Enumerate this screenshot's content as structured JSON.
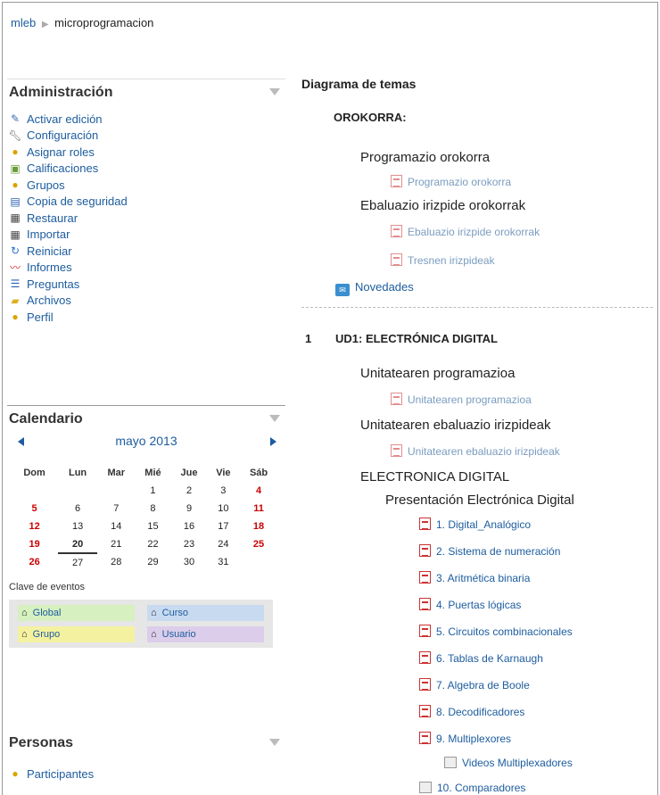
{
  "breadcrumb": {
    "home": "mleb",
    "current": "microprogramacion"
  },
  "admin": {
    "title": "Administración",
    "items": [
      {
        "label": "Activar edición",
        "icon": "pencil-icon"
      },
      {
        "label": "Configuración",
        "icon": "wrench-icon"
      },
      {
        "label": "Asignar roles",
        "icon": "roles-icon"
      },
      {
        "label": "Calificaciones",
        "icon": "grades-icon"
      },
      {
        "label": "Grupos",
        "icon": "groups-icon"
      },
      {
        "label": "Copia de seguridad",
        "icon": "backup-icon"
      },
      {
        "label": "Restaurar",
        "icon": "restore-icon"
      },
      {
        "label": "Importar",
        "icon": "import-icon"
      },
      {
        "label": "Reiniciar",
        "icon": "reset-icon"
      },
      {
        "label": "Informes",
        "icon": "reports-icon"
      },
      {
        "label": "Preguntas",
        "icon": "questions-icon"
      },
      {
        "label": "Archivos",
        "icon": "files-icon"
      },
      {
        "label": "Perfil",
        "icon": "profile-icon"
      }
    ]
  },
  "calendar": {
    "title": "Calendario",
    "month": "mayo 2013",
    "weekdays": [
      "Dom",
      "Lun",
      "Mar",
      "Mié",
      "Jue",
      "Vie",
      "Sáb"
    ],
    "weeks": [
      [
        "",
        "",
        "",
        "1",
        "2",
        "3",
        "4"
      ],
      [
        "5",
        "6",
        "7",
        "8",
        "9",
        "10",
        "11"
      ],
      [
        "12",
        "13",
        "14",
        "15",
        "16",
        "17",
        "18"
      ],
      [
        "19",
        "20",
        "21",
        "22",
        "23",
        "24",
        "25"
      ],
      [
        "26",
        "27",
        "28",
        "29",
        "30",
        "31",
        ""
      ]
    ],
    "today": "20",
    "event_key_title": "Clave de eventos",
    "event_key": {
      "global": "Global",
      "curso": "Curso",
      "grupo": "Grupo",
      "usuario": "Usuario"
    }
  },
  "people": {
    "title": "Personas",
    "participants": "Participantes"
  },
  "content": {
    "heading": "Diagrama de temas",
    "general_title": "OROKORRA:",
    "general_items": {
      "prog_label": "Programazio orokorra",
      "prog_pdf": "Programazio orokorra",
      "eval_label": "Ebaluazio irizpide orokorrak",
      "eval_pdf": "Ebaluazio irizpide orokorrak",
      "tools_pdf": "Tresnen irizpideak",
      "news": "Novedades"
    },
    "section_num": "1",
    "section_title": "UD1: ELECTRÓNICA DIGITAL",
    "unit_prog_label": "Unitatearen programazioa",
    "unit_prog_pdf": "Unitatearen programazioa",
    "unit_eval_label": "Unitatearen ebaluazio irizpideak",
    "unit_eval_pdf": "Unitatearen ebaluazio irizpideak",
    "ed_label": "ELECTRONICA DIGITAL",
    "presentation_label": "Presentación Electrónica Digital",
    "lessons": [
      "1. Digital_Analógico",
      "2. Sistema de numeración",
      "3. Aritmética binaria",
      "4. Puertas lógicas",
      "5. Circuitos combinacionales",
      "6. Tablas de Karnaugh",
      "7. Algebra de Boole",
      "8. Decodificadores",
      "9. Multiplexores"
    ],
    "video_label": "Videos Multiplexadores",
    "next_label": "10. Comparadores"
  }
}
